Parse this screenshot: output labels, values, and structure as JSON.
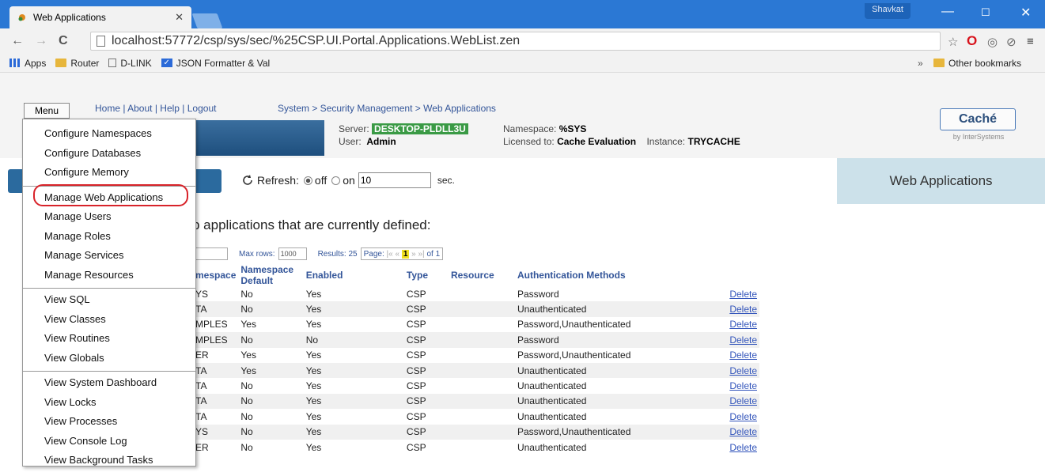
{
  "browser": {
    "tab_title": "Web Applications",
    "user_badge": "Shavkat",
    "url": "localhost:57772/csp/sys/sec/%25CSP.UI.Portal.Applications.WebList.zen",
    "bookmarks": [
      "Apps",
      "Router",
      "D-LINK",
      "JSON Formatter & Val"
    ],
    "other_bookmarks": "Other bookmarks",
    "overflow": "»"
  },
  "portal": {
    "menu_label": "Menu",
    "top_links": "Home | About | Help | Logout",
    "breadcrumb": "System > Security Management > Web Applications",
    "server_label": "Server:",
    "server_value": "DESKTOP-PLDLL3U",
    "user_label": "User:",
    "user_value": "Admin",
    "namespace_label": "Namespace:",
    "namespace_value": "%SYS",
    "licensed_label": "Licensed to:",
    "licensed_value": "Cache Evaluation",
    "instance_label": "Instance:",
    "instance_value": "TRYCACHE",
    "logo": "Caché",
    "logo_sub": "by InterSystems",
    "page_title": "Web Applications"
  },
  "refresh": {
    "label": "Refresh:",
    "off": "off",
    "on": "on",
    "interval": "10",
    "unit": "sec."
  },
  "intro_text": "b applications that are currently defined:",
  "filter": {
    "max_rows_label": "Max rows:",
    "max_rows_value": "1000",
    "results_label": "Results: 25",
    "page_label": "Page:",
    "page_first": "|«",
    "page_prev": "«",
    "page_current": "1",
    "page_next": "»",
    "page_last": "»|",
    "page_of": "of 1"
  },
  "table": {
    "headers": [
      "mespace",
      "Namespace Default",
      "Enabled",
      "Type",
      "Resource",
      "Authentication Methods",
      ""
    ],
    "rows": [
      [
        "YS",
        "No",
        "Yes",
        "CSP",
        "",
        "Password",
        "Delete"
      ],
      [
        "TA",
        "No",
        "Yes",
        "CSP",
        "",
        "Unauthenticated",
        "Delete"
      ],
      [
        "MPLES",
        "Yes",
        "Yes",
        "CSP",
        "",
        "Password,Unauthenticated",
        "Delete"
      ],
      [
        "MPLES",
        "No",
        "No",
        "CSP",
        "",
        "Password",
        "Delete"
      ],
      [
        "ER",
        "Yes",
        "Yes",
        "CSP",
        "",
        "Password,Unauthenticated",
        "Delete"
      ],
      [
        "TA",
        "Yes",
        "Yes",
        "CSP",
        "",
        "Unauthenticated",
        "Delete"
      ],
      [
        "TA",
        "No",
        "Yes",
        "CSP",
        "",
        "Unauthenticated",
        "Delete"
      ],
      [
        "TA",
        "No",
        "Yes",
        "CSP",
        "",
        "Unauthenticated",
        "Delete"
      ],
      [
        "TA",
        "No",
        "Yes",
        "CSP",
        "",
        "Unauthenticated",
        "Delete"
      ],
      [
        "YS",
        "No",
        "Yes",
        "CSP",
        "",
        "Password,Unauthenticated",
        "Delete"
      ],
      [
        "ER",
        "No",
        "Yes",
        "CSP",
        "",
        "Unauthenticated",
        "Delete"
      ]
    ]
  },
  "menu": {
    "group1": [
      "Configure Namespaces",
      "Configure Databases",
      "Configure Memory"
    ],
    "group2": [
      "Manage Web Applications",
      "Manage Users",
      "Manage Roles",
      "Manage Services",
      "Manage Resources"
    ],
    "group3": [
      "View SQL",
      "View Classes",
      "View Routines",
      "View Globals"
    ],
    "group4": [
      "View System Dashboard",
      "View Locks",
      "View Processes",
      "View Console Log",
      "View Background Tasks"
    ]
  }
}
